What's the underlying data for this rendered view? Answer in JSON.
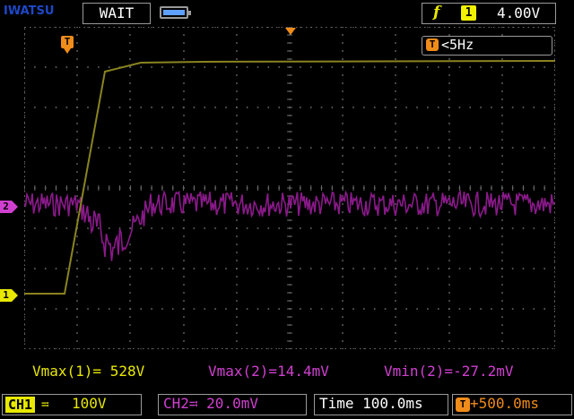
{
  "header": {
    "brand": "IWATSU",
    "run_state": "WAIT",
    "battery_icon": "battery-icon",
    "trigger_slope": "f",
    "trigger_source": "1",
    "trigger_level": "4.00V"
  },
  "frequency": {
    "icon": "T",
    "value": "<5Hz"
  },
  "markers": {
    "trigger_position": "T",
    "ch1": "1",
    "ch2": "2"
  },
  "measurements": {
    "vmax_ch1": "Vmax(1)= 528V",
    "vmax_ch2": "Vmax(2)=14.4mV",
    "vmin_ch2": "Vmin(2)=-27.2mV"
  },
  "footer": {
    "ch1_label": "CH1",
    "ch1_coupling": "≕",
    "ch1_scale": "100V",
    "ch2_label": "CH2≕ 20.0mV",
    "time_label": "Time 100.0ms",
    "trigger_pos_icon": "T",
    "trigger_pos_value": "+500.0ms"
  },
  "colors": {
    "ch1": "#e8e800",
    "ch1_trace": "#8a8420",
    "ch2": "#d040d0",
    "ch2_trace": "#8a1a8a",
    "trigger": "#f08c1a",
    "grid": "#6a6a6a",
    "brand": "#1e48c8"
  }
}
